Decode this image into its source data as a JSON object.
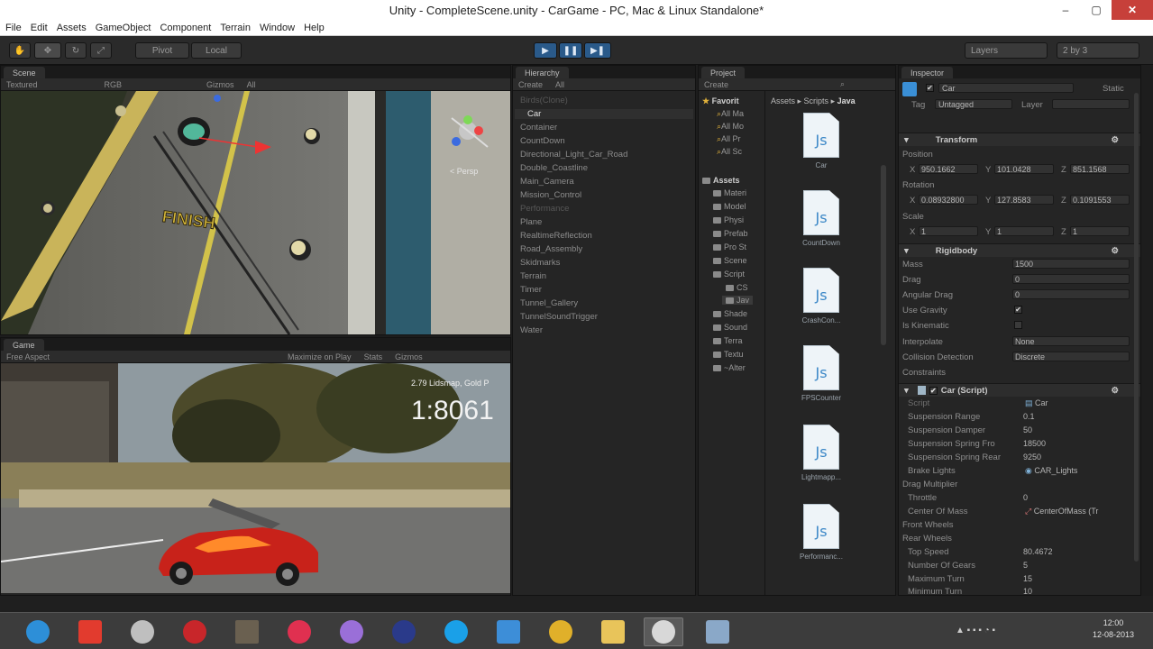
{
  "window": {
    "title": "Unity - CompleteScene.unity - CarGame - PC, Mac & Linux Standalone*",
    "min": "–",
    "max": "▢",
    "close": "✕"
  },
  "menu": [
    "File",
    "Edit",
    "Assets",
    "GameObject",
    "Component",
    "Terrain",
    "Window",
    "Help"
  ],
  "toolbar": {
    "pivot": "Pivot",
    "local": "Local",
    "layers": "Layers",
    "layout": "2 by 3"
  },
  "scene": {
    "tab": "Scene",
    "shading": "Textured",
    "rgb": "RGB",
    "gizmos": "Gizmos",
    "all": "All",
    "persp": "< Persp",
    "finish_sign": "FINISH"
  },
  "game": {
    "tab": "Game",
    "aspect": "Free Aspect",
    "maximize": "Maximize on Play",
    "stats": "Stats",
    "gizmos": "Gizmos",
    "overlay_small": "2.79 Lidsmap, Gold P",
    "overlay_big": "1:8061"
  },
  "hierarchy": {
    "tab": "Hierarchy",
    "create": "Create",
    "search_all": "All",
    "items": [
      "Birds(Clone)",
      "Car",
      "Container",
      "CountDown",
      "Directional_Light_Car_Road",
      "Double_Coastline",
      "Main_Camera",
      "Mission_Control",
      "Performance",
      "Plane",
      "RealtimeReflection",
      "Road_Assembly",
      "Skidmarks",
      "Terrain",
      "Timer",
      "Tunnel_Gallery",
      "TunnelSoundTrigger",
      "Water"
    ]
  },
  "project": {
    "tab": "Project",
    "create": "Create",
    "breadcrumb": [
      "Assets",
      "Scripts",
      "Java"
    ],
    "favorites_label": "Favorit",
    "favorites": [
      "All Ma",
      "All Mo",
      "All Pr",
      "All Sc"
    ],
    "assets_label": "Assets",
    "folders": [
      "Materi",
      "Model",
      "Physi",
      "Prefab",
      "Pro St",
      "Scene",
      "Script",
      "CS",
      "Jav",
      "Shade",
      "Sound",
      "Terra",
      "Textu",
      "~Alter"
    ],
    "files": [
      "Car",
      "CountDown",
      "CrashCon...",
      "FPSCounter",
      "Lightmapp...",
      "Performanc..."
    ]
  },
  "inspector": {
    "tab": "Inspector",
    "object_name": "Car",
    "static": "Static",
    "tag_label": "Tag",
    "tag_value": "Untagged",
    "layer_label": "Layer",
    "transform": {
      "title": "Transform",
      "position": "Position",
      "rotation": "Rotation",
      "scale": "Scale",
      "pos": [
        "950.1662",
        "101.0428",
        "851.1568"
      ],
      "rot": [
        "0.08932800",
        "127.8583",
        "0.1091553"
      ],
      "sca": [
        "1",
        "1",
        "1"
      ],
      "axes": [
        "X",
        "Y",
        "Z"
      ]
    },
    "rigidbody": {
      "title": "Rigidbody",
      "rows": [
        {
          "label": "Mass",
          "value": "1500"
        },
        {
          "label": "Drag",
          "value": "0"
        },
        {
          "label": "Angular Drag",
          "value": "0"
        },
        {
          "label": "Use Gravity",
          "value": "✔"
        },
        {
          "label": "Is Kinematic",
          "value": ""
        },
        {
          "label": "Interpolate",
          "value": "None"
        },
        {
          "label": "Collision Detection",
          "value": "Discrete"
        },
        {
          "label": "Constraints",
          "value": ""
        }
      ]
    },
    "car_script": {
      "title": "Car (Script)",
      "rows": [
        {
          "label": "Script",
          "value": "Car"
        },
        {
          "label": "Suspension Range",
          "value": "0.1"
        },
        {
          "label": "Suspension Damper",
          "value": "50"
        },
        {
          "label": "Suspension Spring Fro",
          "value": "18500"
        },
        {
          "label": "Suspension Spring Rear",
          "value": "9250"
        },
        {
          "label": "Brake Lights",
          "value": "CAR_Lights"
        },
        {
          "label": "Drag Multiplier",
          "value": ""
        },
        {
          "label": "Throttle",
          "value": "0"
        },
        {
          "label": "Center Of Mass",
          "value": "CenterOfMass (Tr"
        },
        {
          "label": "Front Wheels",
          "value": ""
        },
        {
          "label": "Rear Wheels",
          "value": ""
        },
        {
          "label": "Top Speed",
          "value": "80.4672"
        },
        {
          "label": "Number Of Gears",
          "value": "5"
        },
        {
          "label": "Maximum Turn",
          "value": "15"
        },
        {
          "label": "Minimum Turn",
          "value": "10"
        }
      ]
    }
  },
  "taskbar": {
    "time": "12:00",
    "date": "12-08-2013",
    "apps": [
      "ie-icon",
      "opera-icon",
      "media-icon",
      "chrome-dev-icon",
      "film-icon",
      "bandicam-icon",
      "globe-icon",
      "headphones-icon",
      "skype-icon",
      "dropbox-icon",
      "chrome-icon",
      "explorer-icon",
      "unity-icon",
      "remote-icon"
    ]
  },
  "colors": {
    "accent": "#2a5a8a",
    "close": "#c7403a",
    "dark_bg": "#252525"
  }
}
